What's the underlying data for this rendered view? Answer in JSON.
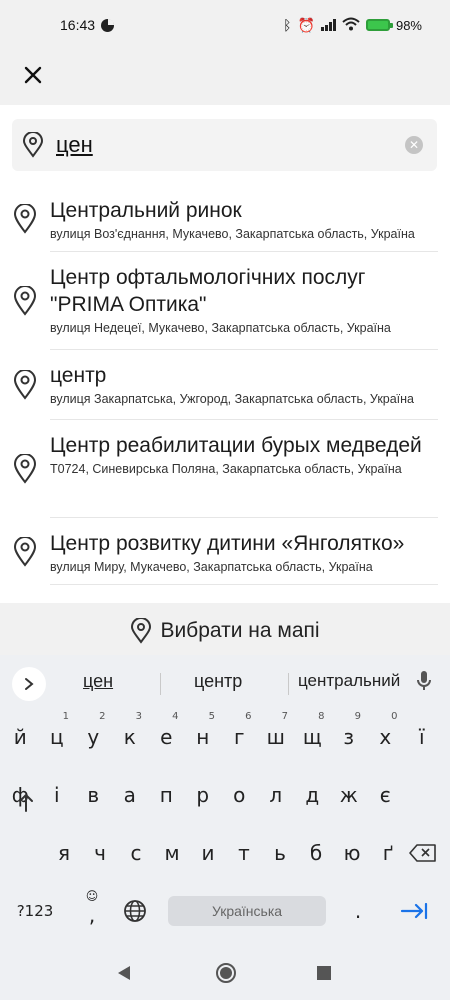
{
  "status_bar": {
    "time": "16:43",
    "battery": "98%"
  },
  "search": {
    "value": "цен"
  },
  "results": [
    {
      "title": "Центральний ринок",
      "subtitle": "вулиця Воз'єднання, Мукачево, Закарпатська область, Україна"
    },
    {
      "title": "Центр офтальмологічних послуг \"PRIMA Оптика\"",
      "subtitle": "вулиця Недецеї, Мукачево, Закарпатська область, Україна"
    },
    {
      "title": "центр",
      "subtitle": "вулиця Закарпатська, Ужгород, Закарпатська область, Україна"
    },
    {
      "title": "Центр реабилитации бурых медведей",
      "subtitle": "T0724, Синевирська Поляна, Закарпатська область, Україна"
    },
    {
      "title": "Центр розвитку дитини «Янголятко»",
      "subtitle": "вулиця Миру, Мукачево, Закарпатська область, Україна"
    }
  ],
  "map_pick_label": "Вибрати на мапі",
  "keyboard": {
    "suggestions": [
      "цен",
      "центр",
      "центральний"
    ],
    "row1": [
      "й",
      "ц",
      "у",
      "к",
      "е",
      "н",
      "г",
      "ш",
      "щ",
      "з",
      "х",
      "ї"
    ],
    "row1_hints": [
      "",
      "1",
      "2",
      "3",
      "4",
      "5",
      "6",
      "7",
      "8",
      "9",
      "0",
      ""
    ],
    "row2": [
      "ф",
      "і",
      "в",
      "а",
      "п",
      "р",
      "о",
      "л",
      "д",
      "ж",
      "є"
    ],
    "row3": [
      "я",
      "ч",
      "с",
      "м",
      "и",
      "т",
      "ь",
      "б",
      "ю",
      "ґ"
    ],
    "symbols_key": "?123",
    "comma_key": ",",
    "period_key": ".",
    "space_label": "Українська"
  }
}
